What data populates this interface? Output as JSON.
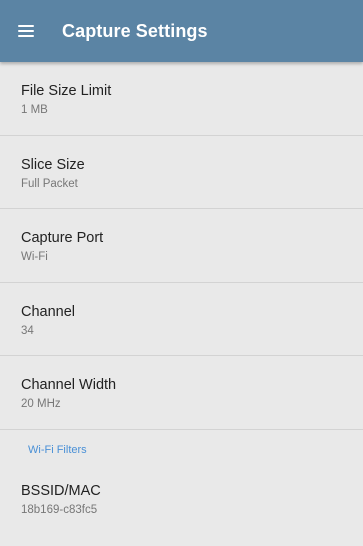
{
  "appbar": {
    "title": "Capture Settings",
    "menu_icon": "hamburger-menu-icon"
  },
  "settings": [
    {
      "label": "File Size Limit",
      "value": "1 MB"
    },
    {
      "label": "Slice Size",
      "value": "Full Packet"
    },
    {
      "label": "Capture Port",
      "value": "Wi-Fi"
    },
    {
      "label": "Channel",
      "value": "34"
    },
    {
      "label": "Channel Width",
      "value": "20 MHz"
    }
  ],
  "wifi_filters": {
    "header": "Wi-Fi Filters",
    "items": [
      {
        "label": "BSSID/MAC",
        "value": "18b169-c83fc5"
      }
    ]
  },
  "colors": {
    "appbar": "#5b84a4",
    "background": "#e9e9e9",
    "section_header": "#4a90d6"
  }
}
